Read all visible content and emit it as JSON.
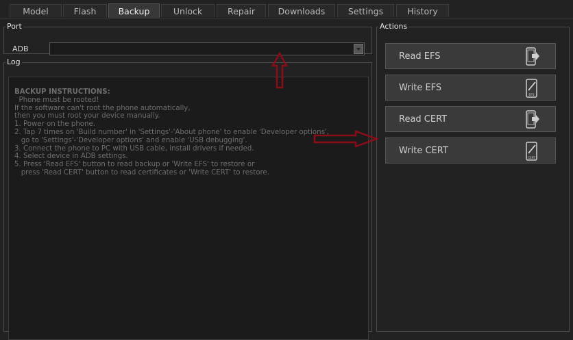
{
  "tabs": [
    "Model",
    "Flash",
    "Backup",
    "Unlock",
    "Repair",
    "Downloads",
    "Settings",
    "History"
  ],
  "active_tab": "Backup",
  "port": {
    "legend": "Port",
    "label": "ADB",
    "value": ""
  },
  "log": {
    "legend": "Log",
    "heading": "BACKUP INSTRUCTIONS:",
    "lines": [
      "  Phone must be rooted!",
      "If the software can't root the phone automatically,",
      "then you must root your device manually.",
      "1. Power on the phone.",
      "2. Tap 7 times on 'Build number' in 'Settings'-'About phone' to enable 'Developer options',",
      "   go to 'Settings'-'Developer options' and enable 'USB debugging'.",
      "3. Connect the phone to PC with USB cable, install drivers if needed.",
      "4. Select device in ADB settings.",
      "5. Press 'Read EFS' button to read backup or 'Write EFS' to restore or",
      "   press 'Read CERT' button to read certificates or 'Write CERT' to restore."
    ]
  },
  "actions": {
    "legend": "Actions",
    "buttons": [
      {
        "label": "Read EFS",
        "icon": "phone-read-icon"
      },
      {
        "label": "Write EFS",
        "icon": "phone-write-efs-icon",
        "badge": "EFS"
      },
      {
        "label": "Read CERT",
        "icon": "phone-read-icon"
      },
      {
        "label": "Write CERT",
        "icon": "phone-write-cert-icon",
        "badge": "CERT"
      }
    ]
  },
  "colors": {
    "annotation_arrow": "#8b0d1a",
    "background": "#222222"
  }
}
